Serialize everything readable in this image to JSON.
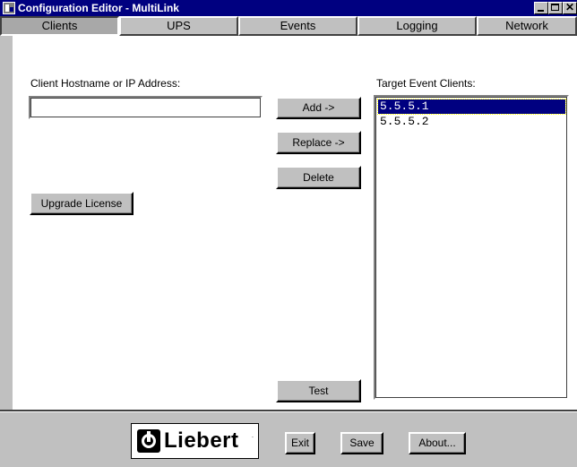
{
  "window": {
    "title": "Configuration Editor - MultiLink"
  },
  "tabs": [
    {
      "label": "Clients",
      "active": true
    },
    {
      "label": "UPS",
      "active": false
    },
    {
      "label": "Events",
      "active": false
    },
    {
      "label": "Logging",
      "active": false
    },
    {
      "label": "Network",
      "active": false
    }
  ],
  "clients": {
    "hostname_label": "Client Hostname or IP Address:",
    "hostname_value": "",
    "targets_label": "Target Event Clients:",
    "targets": [
      {
        "address": "5.5.5.1",
        "selected": true
      },
      {
        "address": "5.5.5.2",
        "selected": false
      }
    ],
    "add_label": "Add ->",
    "replace_label": "Replace ->",
    "delete_label": "Delete",
    "upgrade_label": "Upgrade License",
    "test_label": "Test"
  },
  "footer": {
    "logo_text": "Liebert",
    "logo_tm": ".",
    "exit_label": "Exit",
    "save_label": "Save",
    "about_label": "About..."
  },
  "colors": {
    "titlebar": "#000080",
    "face": "#c0c0c0",
    "selection": "#000080"
  }
}
